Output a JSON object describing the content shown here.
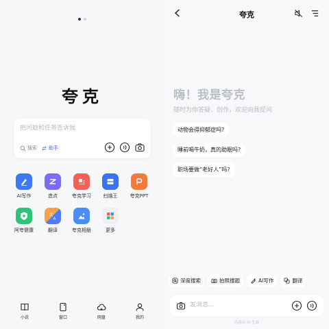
{
  "left": {
    "title": "夸克",
    "search": {
      "placeholder": "把问题和任务告诉我",
      "modes": [
        "搜索",
        "助手"
      ]
    },
    "apps": [
      {
        "label": "AI写作",
        "icon": "ai-writing-icon",
        "color": "#3d78f5"
      },
      {
        "label": "造点",
        "icon": "zaodian-icon",
        "color": "#7a6cf6"
      },
      {
        "label": "夸克学习",
        "icon": "study-icon",
        "color": "#f26157"
      },
      {
        "label": "扫描王",
        "icon": "scanner-icon",
        "color": "#3a72f0"
      },
      {
        "label": "夸克PPT",
        "icon": "ppt-icon",
        "color": "#f47a3c"
      },
      {
        "label": "阿夸健康",
        "icon": "health-icon",
        "color": "#2fc27a"
      },
      {
        "label": "翻译",
        "icon": "translate-icon",
        "color": "#4f7cf7"
      },
      {
        "label": "夸克相册",
        "icon": "album-icon",
        "color": "#4a8ef5"
      },
      {
        "label": "更多",
        "icon": "more-icon",
        "color": "#eef0f4"
      }
    ],
    "tabs": [
      {
        "label": "小说",
        "icon": "book-icon"
      },
      {
        "label": "窗口",
        "icon": "window-icon"
      },
      {
        "label": "网盘",
        "icon": "cloud-icon"
      },
      {
        "label": "我的",
        "icon": "profile-icon"
      }
    ]
  },
  "right": {
    "title": "夸克",
    "greeting": "嗨！我是夸克",
    "subtitle": "随时为你答疑、创作，欢迎向我提问",
    "suggestions": [
      "动物会得抑郁症吗?",
      "睡前喝牛奶，真的助眠吗?",
      "职场要做“老好人”吗?"
    ],
    "tools": [
      {
        "label": "深度搜索",
        "icon": "deep-search-icon"
      },
      {
        "label": "拍照搜题",
        "icon": "photo-search-icon"
      },
      {
        "label": "AI写作",
        "icon": "ai-write-icon"
      },
      {
        "label": "翻译",
        "icon": "translate-icon"
      }
    ],
    "input": {
      "placeholder": "发消息..."
    },
    "footnote": "内容由 AI 生成"
  }
}
